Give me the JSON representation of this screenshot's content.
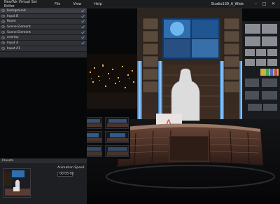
{
  "app": {
    "title": "NewTek Virtual Set Editor"
  },
  "menu": {
    "file": "File",
    "view": "View",
    "help": "Help"
  },
  "scene_name": "Studio139_A_Wide",
  "layers": [
    {
      "label": "background",
      "checked": true
    },
    {
      "label": "Input B",
      "checked": true
    },
    {
      "label": "Room",
      "checked": true
    },
    {
      "label": "Scene Element",
      "checked": true
    },
    {
      "label": "Scene Element",
      "checked": true
    },
    {
      "label": "overlay",
      "checked": true
    },
    {
      "label": "Input A",
      "checked": true
    },
    {
      "label": "Input A1",
      "checked": false
    }
  ],
  "presets": {
    "heading": "Presets"
  },
  "animation": {
    "label": "Animation Speed",
    "value": "00:05:00"
  },
  "desk_letter": "A",
  "colors": {
    "accent": "#3e8fd6",
    "checkbox": "#4a9be0",
    "desk_logo": "#e8464a"
  }
}
